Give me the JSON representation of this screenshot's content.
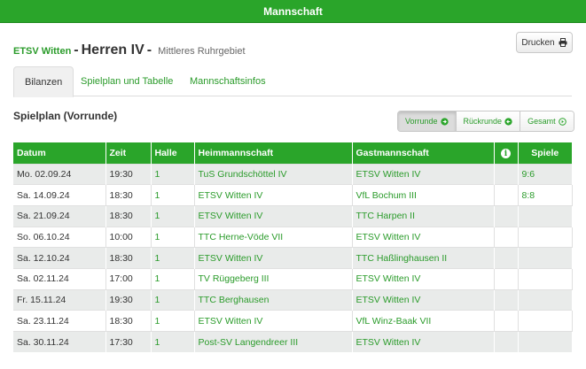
{
  "header": {
    "title": "Mannschaft"
  },
  "print_label": "Drucken",
  "title": {
    "club": "ETSV Witten",
    "sep1": "-",
    "team": "Herren IV",
    "sep2": "-",
    "league": "Mittleres Ruhrgebiet"
  },
  "tabs": [
    {
      "label": "Bilanzen",
      "active": true
    },
    {
      "label": "Spielplan und Tabelle"
    },
    {
      "label": "Mannschaftsinfos"
    }
  ],
  "section_title": "Spielplan (Vorrunde)",
  "segments": [
    {
      "label": "Vorrunde",
      "icon": "circle-arrow-right-icon",
      "active": true
    },
    {
      "label": "Rückrunde",
      "icon": "circle-arrow-left-icon"
    },
    {
      "label": "Gesamt",
      "icon": "circle-play-icon"
    }
  ],
  "table": {
    "headers": {
      "datum": "Datum",
      "zeit": "Zeit",
      "halle": "Halle",
      "heim": "Heimmannschaft",
      "gast": "Gastmannschaft",
      "info": "info-icon",
      "spiele": "Spiele"
    },
    "rows": [
      {
        "datum": "Mo. 02.09.24",
        "zeit": "19:30",
        "halle": "1",
        "heim": "TuS Grundschöttel IV",
        "gast": "ETSV Witten IV",
        "ergebnis": "9:6",
        "done": true
      },
      {
        "datum": "Sa. 14.09.24",
        "zeit": "18:30",
        "halle": "1",
        "heim": "ETSV Witten IV",
        "gast": "VfL Bochum III",
        "ergebnis": "8:8",
        "done": true
      },
      {
        "datum": "Sa. 21.09.24",
        "zeit": "18:30",
        "halle": "1",
        "heim": "ETSV Witten IV",
        "gast": "TTC Harpen II",
        "ergebnis": "",
        "done": false
      },
      {
        "datum": "So. 06.10.24",
        "zeit": "10:00",
        "halle": "1",
        "heim": "TTC Herne-Vöde VII",
        "gast": "ETSV Witten IV",
        "ergebnis": "",
        "done": false
      },
      {
        "datum": "Sa. 12.10.24",
        "zeit": "18:30",
        "halle": "1",
        "heim": "ETSV Witten IV",
        "gast": "TTC Haßlinghausen II",
        "ergebnis": "",
        "done": false
      },
      {
        "datum": "Sa. 02.11.24",
        "zeit": "17:00",
        "halle": "1",
        "heim": "TV Rüggeberg III",
        "gast": "ETSV Witten IV",
        "ergebnis": "",
        "done": false
      },
      {
        "datum": "Fr. 15.11.24",
        "zeit": "19:30",
        "halle": "1",
        "heim": "TTC Berghausen",
        "gast": "ETSV Witten IV",
        "ergebnis": "",
        "done": false
      },
      {
        "datum": "Sa. 23.11.24",
        "zeit": "18:30",
        "halle": "1",
        "heim": "ETSV Witten IV",
        "gast": "VfL Winz-Baak VII",
        "ergebnis": "",
        "done": false
      },
      {
        "datum": "Sa. 30.11.24",
        "zeit": "17:30",
        "halle": "1",
        "heim": "Post-SV Langendreer III",
        "gast": "ETSV Witten IV",
        "ergebnis": "",
        "done": false
      }
    ]
  },
  "colors": {
    "accent": "#2aa52a",
    "row_alt": "#e9ebea"
  }
}
